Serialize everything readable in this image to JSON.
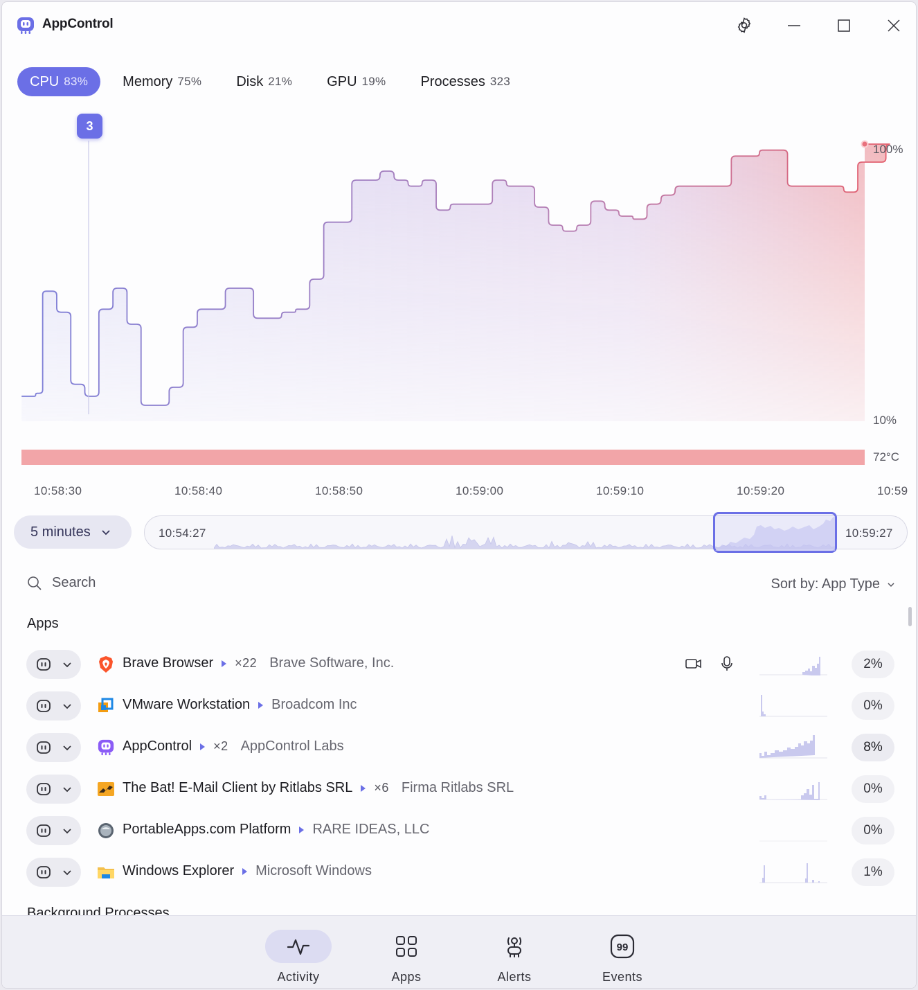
{
  "app": {
    "title": "AppControl",
    "settings_label": "Settings",
    "minimize_label": "Minimize",
    "maximize_label": "Maximize",
    "close_label": "Close"
  },
  "tabs": [
    {
      "label": "CPU",
      "value": "83%",
      "active": true
    },
    {
      "label": "Memory",
      "value": "75%",
      "active": false
    },
    {
      "label": "Disk",
      "value": "21%",
      "active": false
    },
    {
      "label": "GPU",
      "value": "19%",
      "active": false
    },
    {
      "label": "Processes",
      "value": "323",
      "active": false
    }
  ],
  "chart": {
    "marker_label": "3",
    "y_max_label": "100%",
    "y_min_label": "10%",
    "temperature_label": "72°C",
    "time_ticks": [
      "10:58:30",
      "10:58:40",
      "10:58:50",
      "10:59:00",
      "10:59:10",
      "10:59:20",
      "10:59"
    ]
  },
  "chart_data": {
    "type": "area",
    "series_desc": "CPU usage step area over time",
    "ylim": [
      10,
      100
    ],
    "x_seconds_from_first_tick": [
      -2.7,
      -1.7,
      -1.2,
      -0.2,
      0.8,
      1.8,
      2.8,
      3.8,
      4.8,
      5.8,
      6.8,
      7.8,
      8.8,
      9.8,
      10.8,
      11.8,
      12.8,
      13.8,
      14.8,
      15.8,
      16.8,
      17.8,
      18.8,
      19.8,
      20.8,
      21.8,
      22.8,
      23.8,
      24.8,
      25.8,
      26.8,
      27.8,
      28.8,
      29.8,
      30.8,
      31.8,
      32.8,
      33.8,
      34.8,
      35.8,
      36.8,
      37.8,
      38.8,
      39.8,
      40.8,
      41.8,
      42.8,
      43.8,
      44.8,
      45.8,
      46.8,
      47.8,
      48.8,
      49.8,
      50.8,
      51.8,
      52.8,
      53.8,
      54.8,
      55.8,
      56.8,
      57.8,
      58.8,
      59.8,
      60.8,
      61.8,
      62.8,
      63.8,
      64.8,
      65.8,
      66.8,
      67.8,
      68.8,
      69.8,
      70.8,
      71.8,
      72.8,
      73.8,
      74.8
    ],
    "y": [
      16,
      17,
      51,
      44,
      20,
      16,
      45,
      52,
      40,
      13,
      13,
      19,
      39,
      45,
      45,
      52,
      52,
      42,
      42,
      44,
      45,
      55,
      74,
      74,
      88,
      88,
      91,
      88,
      86,
      88,
      78,
      80,
      80,
      80,
      88,
      86,
      86,
      79,
      73,
      71,
      73,
      81,
      78,
      76,
      75,
      80,
      83,
      86,
      86,
      86,
      86,
      96,
      96,
      98,
      98,
      86,
      86,
      86,
      86,
      84,
      94,
      94,
      100
    ],
    "temperature": "72°C",
    "marker": {
      "label": "3",
      "x_seconds_from_first_tick": 2.1
    }
  },
  "range": {
    "duration_label": "5 minutes",
    "start_label": "10:54:27",
    "end_label": "10:59:27"
  },
  "search": {
    "placeholder": "Search"
  },
  "sort": {
    "label": "Sort by: App Type"
  },
  "sections": {
    "apps": "Apps",
    "background": "Background Processes"
  },
  "apps": [
    {
      "name": "Brave Browser",
      "count": "×22",
      "publisher": "Brave Software, Inc.",
      "usage": "2%",
      "camera": true,
      "mic": true,
      "icon": "brave-icon"
    },
    {
      "name": "VMware Workstation",
      "count": "",
      "publisher": "Broadcom Inc",
      "usage": "0%",
      "icon": "vmware-icon"
    },
    {
      "name": "AppControl",
      "count": "×2",
      "publisher": "AppControl Labs",
      "usage": "8%",
      "icon": "appcontrol-icon"
    },
    {
      "name": "The Bat! E-Mail Client by Ritlabs SRL",
      "count": "×6",
      "publisher": "Firma Ritlabs SRL",
      "usage": "0%",
      "icon": "thebat-icon"
    },
    {
      "name": "PortableApps.com Platform",
      "count": "",
      "publisher": "RARE IDEAS, LLC",
      "usage": "0%",
      "icon": "portableapps-icon"
    },
    {
      "name": "Windows Explorer",
      "count": "",
      "publisher": "Microsoft Windows",
      "usage": "1%",
      "icon": "folder-icon"
    }
  ],
  "nav": [
    {
      "label": "Activity",
      "icon": "activity-icon",
      "active": true
    },
    {
      "label": "Apps",
      "icon": "apps-grid-icon",
      "active": false
    },
    {
      "label": "Alerts",
      "icon": "alerts-icon",
      "active": false
    },
    {
      "label": "Events",
      "icon": "events-icon",
      "active": false
    }
  ],
  "colors": {
    "accent": "#6b6fe6",
    "hot": "#e88a94",
    "temperature_bar": "#f2a5a8"
  }
}
